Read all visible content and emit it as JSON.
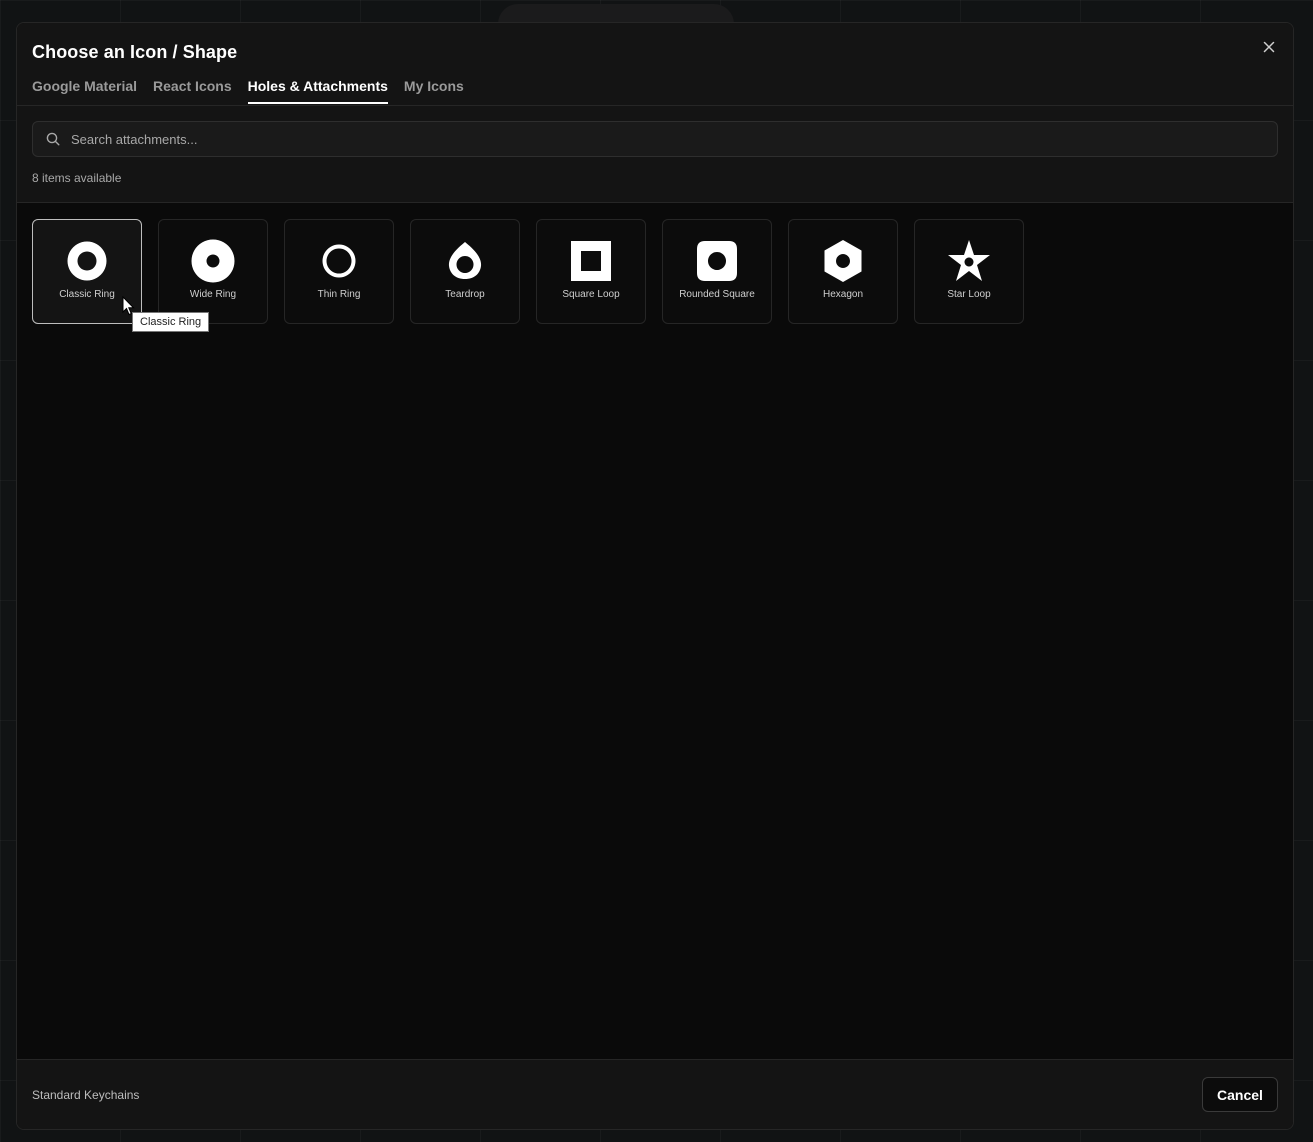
{
  "modal": {
    "title": "Choose an Icon / Shape",
    "close_icon": "close-icon"
  },
  "tabs": [
    {
      "label": "Google Material",
      "active": false
    },
    {
      "label": "React Icons",
      "active": false
    },
    {
      "label": "Holes & Attachments",
      "active": true
    },
    {
      "label": "My Icons",
      "active": false
    }
  ],
  "search": {
    "placeholder": "Search attachments...",
    "value": "",
    "icon": "search-icon"
  },
  "items_count": "8 items available",
  "items": [
    {
      "label": "Classic Ring",
      "icon": "classic-ring-icon",
      "hovered": true
    },
    {
      "label": "Wide Ring",
      "icon": "wide-ring-icon",
      "hovered": false
    },
    {
      "label": "Thin Ring",
      "icon": "thin-ring-icon",
      "hovered": false
    },
    {
      "label": "Teardrop",
      "icon": "teardrop-icon",
      "hovered": false
    },
    {
      "label": "Square Loop",
      "icon": "square-loop-icon",
      "hovered": false
    },
    {
      "label": "Rounded Square",
      "icon": "rounded-square-icon",
      "hovered": false
    },
    {
      "label": "Hexagon",
      "icon": "hexagon-icon",
      "hovered": false
    },
    {
      "label": "Star Loop",
      "icon": "star-loop-icon",
      "hovered": false
    }
  ],
  "tooltip": "Classic Ring",
  "footer": {
    "label": "Standard Keychains",
    "cancel_label": "Cancel"
  }
}
